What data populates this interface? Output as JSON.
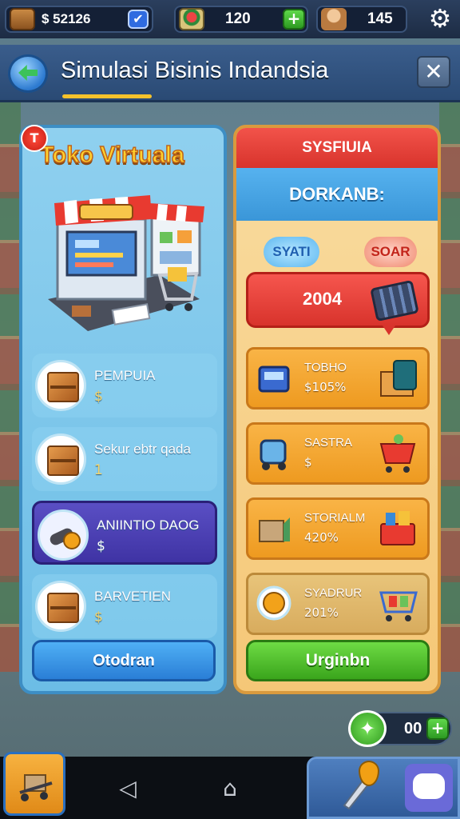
{
  "topbar": {
    "money": "$ 52126",
    "gems": "120",
    "fame": "145"
  },
  "header": {
    "title": "Simulasi Bisinis Indandsia"
  },
  "left_panel": {
    "badge": "T",
    "title": "Toko Virtuala",
    "items": [
      {
        "label": "PEMPUIA",
        "value": "$",
        "active": false
      },
      {
        "label": "Sekur ebtr qada",
        "value": "1",
        "active": false
      },
      {
        "label": "ANIINTIO DAOG",
        "value": "$",
        "active": true
      },
      {
        "label": "BARVETIEN",
        "value": "$",
        "active": false
      }
    ],
    "button": "Otodran"
  },
  "right_panel": {
    "header": "SYSFIUIA",
    "subheader": "DORKANB:",
    "tag_left": "SYATI",
    "tag_right": "SOAR",
    "highlight_value": "2004",
    "items": [
      {
        "label": "TOBHO",
        "value": "$105%"
      },
      {
        "label": "SASTRA",
        "value": "$"
      },
      {
        "label": "STORIALM",
        "value": "420%"
      },
      {
        "label": "SYADRUR",
        "value": "201%"
      }
    ],
    "button": "Urginbn"
  },
  "bottom": {
    "counter_value": "00"
  },
  "colors": {
    "left_panel": "#7cc6ea",
    "right_panel": "#f5c777",
    "accent_yellow": "#f5c22b",
    "accent_green": "#3aa51c",
    "accent_red": "#d8332c"
  }
}
